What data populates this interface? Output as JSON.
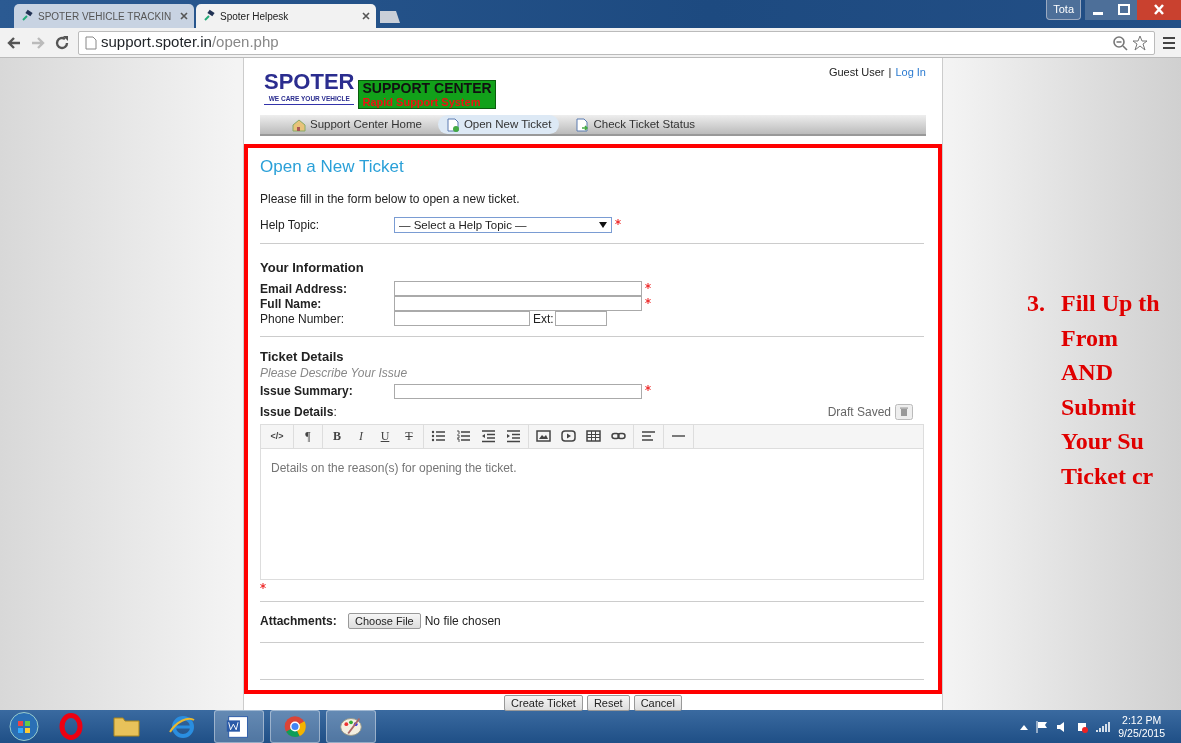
{
  "browser": {
    "tabs": [
      {
        "title": "SPOTER VEHICLE TRACKIN",
        "selected": false
      },
      {
        "title": "Spoter Helpesk",
        "selected": true
      }
    ],
    "profile": "Tota",
    "url_host": "support.spoter.in",
    "url_path": "/open.php"
  },
  "site": {
    "logo_word": "SPOTER",
    "logo_tagline": "WE CARE YOUR VEHICLE",
    "badge_title": "SUPPORT CENTER",
    "badge_subtitle": "Rapid Support System",
    "user": "Guest User",
    "separator": "|",
    "login": "Log In",
    "nav": [
      {
        "label": "Support Center Home",
        "kind": "home",
        "selected": false
      },
      {
        "label": "Open New Ticket",
        "kind": "new",
        "selected": true
      },
      {
        "label": "Check Ticket Status",
        "kind": "status",
        "selected": false
      }
    ]
  },
  "form": {
    "title": "Open a New Ticket",
    "intro": "Please fill in the form below to open a new ticket.",
    "help_topic": {
      "label": "Help Topic:",
      "value": "— Select a Help Topic —",
      "required": true
    },
    "info_heading": "Your Information",
    "info_fields": [
      {
        "label": "Email Address:",
        "bold": true,
        "required": true
      },
      {
        "label": "Full Name:",
        "bold": true,
        "required": true
      },
      {
        "label": "Phone Number:",
        "bold": false,
        "required": false,
        "ext_label": "Ext:"
      }
    ],
    "details_heading": "Ticket Details",
    "details_subtitle": "Please Describe Your Issue",
    "summary": {
      "label": "Issue Summary:",
      "required": true
    },
    "details_label": "Issue Details",
    "details_colon": ":",
    "draft_status": "Draft Saved",
    "toolbar": [
      {
        "items": [
          {
            "kind": "code",
            "text": "</>"
          }
        ]
      },
      {
        "items": [
          {
            "kind": "format",
            "text": "¶"
          }
        ]
      },
      {
        "items": [
          {
            "kind": "bold",
            "text": "B"
          },
          {
            "kind": "italic",
            "text": "I"
          },
          {
            "kind": "underline",
            "text": "U"
          },
          {
            "kind": "strike",
            "text": "T"
          }
        ]
      },
      {
        "items": [
          {
            "kind": "bullets"
          },
          {
            "kind": "numbers"
          },
          {
            "kind": "outdent"
          },
          {
            "kind": "indent"
          }
        ]
      },
      {
        "items": [
          {
            "kind": "image"
          },
          {
            "kind": "video"
          },
          {
            "kind": "table"
          },
          {
            "kind": "link"
          }
        ]
      },
      {
        "items": [
          {
            "kind": "align"
          }
        ]
      },
      {
        "items": [
          {
            "kind": "rule"
          }
        ]
      }
    ],
    "details_placeholder": "Details on the reason(s) for opening the ticket.",
    "details_required": true,
    "attachments_label": "Attachments:",
    "choose_file": "Choose File",
    "no_file": "No file chosen",
    "buttons": [
      "Create Ticket",
      "Reset",
      "Cancel"
    ]
  },
  "annotation": {
    "number": "3.",
    "lines": [
      "Fill Up th",
      "From",
      "AND",
      "Submit",
      "Your Su",
      "Ticket cr"
    ]
  },
  "taskbar": {
    "apps": [
      {
        "kind": "opera",
        "running": false
      },
      {
        "kind": "folder",
        "running": false
      },
      {
        "kind": "ie",
        "running": false
      },
      {
        "kind": "word",
        "running": true
      },
      {
        "kind": "chrome",
        "running": true
      },
      {
        "kind": "paint",
        "running": true
      }
    ],
    "time": "2:12 PM",
    "date": "9/25/2015"
  }
}
